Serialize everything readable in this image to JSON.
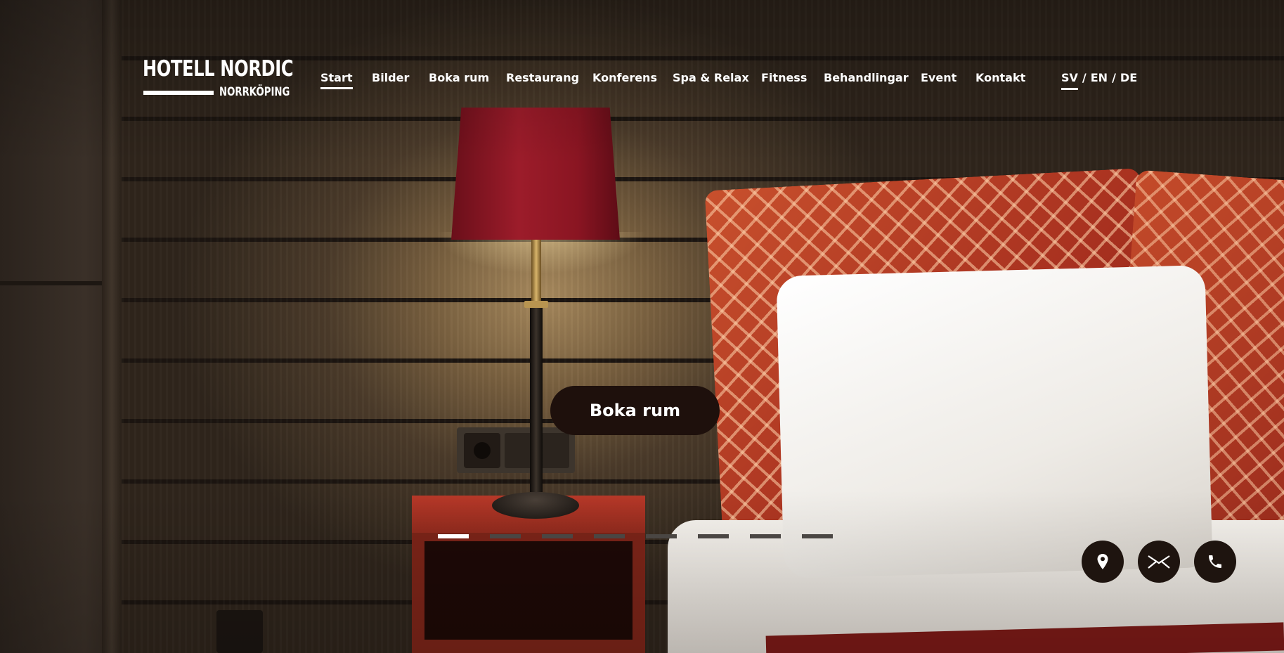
{
  "logo": {
    "title": "HOTELL NORDIC",
    "subtitle": "NORRKÖPING"
  },
  "nav": {
    "items": [
      {
        "label": "Start",
        "active": true
      },
      {
        "label": "Bilder",
        "active": false
      },
      {
        "label": "Boka rum",
        "active": false
      },
      {
        "label": "Restaurang",
        "active": false
      },
      {
        "label": "Konferens",
        "active": false
      },
      {
        "label": "Spa & Relax",
        "active": false
      },
      {
        "label": "Fitness",
        "active": false
      },
      {
        "label": "Behandlingar",
        "active": false
      },
      {
        "label": "Event",
        "active": false
      },
      {
        "label": "Kontakt",
        "active": false
      }
    ]
  },
  "languages": {
    "items": [
      "SV",
      "EN",
      "DE"
    ],
    "active": "SV",
    "separator": "/"
  },
  "cta": {
    "label": "Boka rum"
  },
  "slider": {
    "slide_count": 8,
    "active_index": 0
  },
  "contact_buttons": [
    {
      "icon": "location-pin-icon"
    },
    {
      "icon": "envelope-icon"
    },
    {
      "icon": "phone-icon"
    }
  ],
  "colors": {
    "text": "#ffffff",
    "button_bg": "#1e140f",
    "dot_inactive": "#4a4643",
    "dot_active": "#ffffff"
  }
}
